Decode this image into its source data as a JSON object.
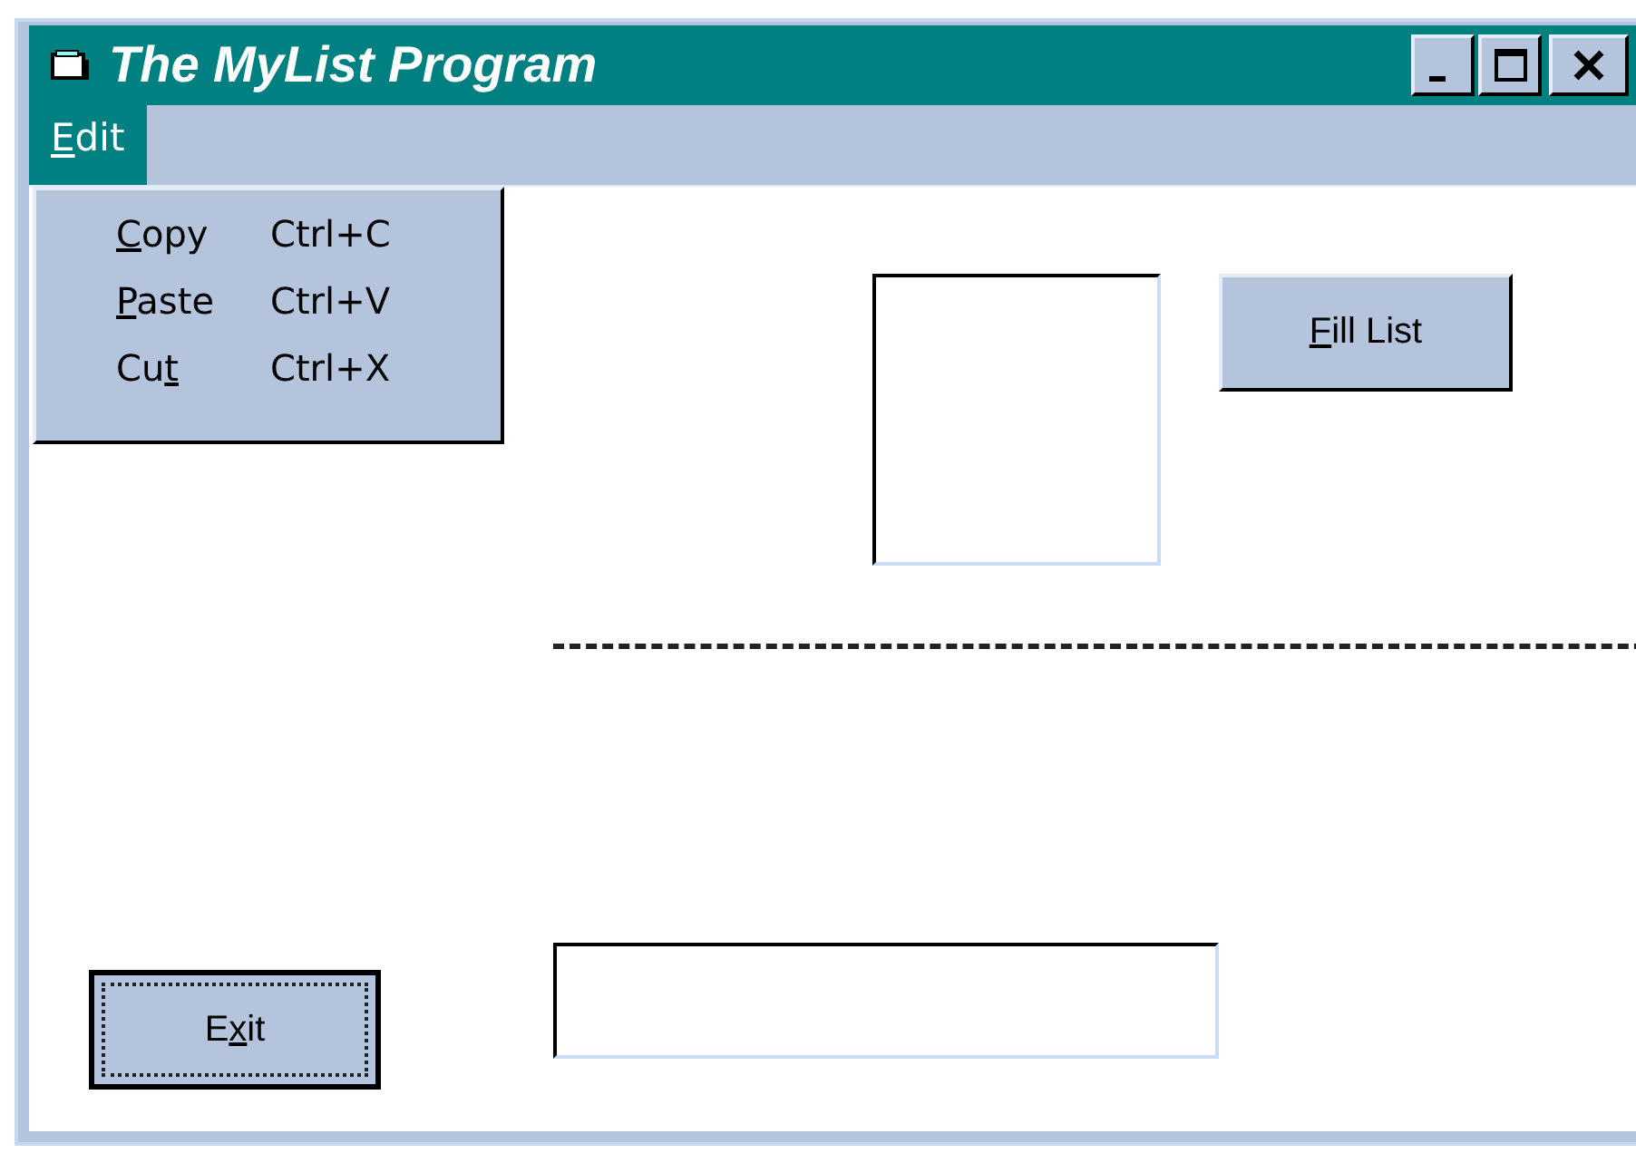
{
  "window": {
    "title": "The MyList Program"
  },
  "menu_bar": [
    {
      "label": {
        "key": "E",
        "post": "dit"
      },
      "selected": true
    }
  ],
  "edit_menu": [
    {
      "label": {
        "key": "C",
        "post": "opy"
      },
      "shortcut": "Ctrl+C"
    },
    {
      "label": {
        "key": "P",
        "post": "aste"
      },
      "shortcut": "Ctrl+V"
    },
    {
      "label": {
        "pre": "Cu",
        "key": "t"
      },
      "shortcut": "Ctrl+X"
    }
  ],
  "buttons": [
    {
      "kind": "fill",
      "label": {
        "key": "F",
        "post": "ill List"
      },
      "focused": false
    },
    {
      "kind": "exit",
      "label": {
        "pre": "E",
        "key": "x",
        "post": "it"
      },
      "focused": true
    }
  ]
}
